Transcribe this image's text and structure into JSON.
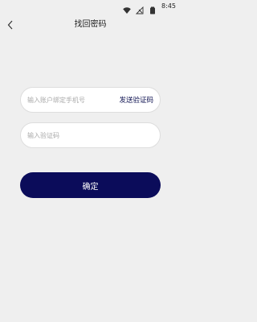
{
  "status_bar": {
    "time": "8:45"
  },
  "header": {
    "title": "找回密码"
  },
  "form": {
    "phone_placeholder": "输入账户绑定手机号",
    "send_code_label": "发送验证码",
    "code_placeholder": "输入验证码",
    "confirm_label": "确定"
  },
  "colors": {
    "background": "#efefef",
    "accent": "#0b0c5a"
  }
}
